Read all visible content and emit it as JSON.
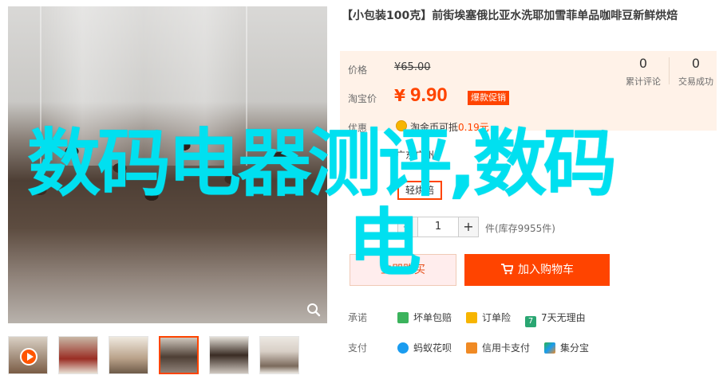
{
  "product": {
    "title": "【小包装100克】前街埃塞俄比亚水洗耶加雪菲单品咖啡豆新鲜烘焙"
  },
  "price": {
    "list_label": "价格",
    "list_price": "¥65.00",
    "promo_label": "淘宝价",
    "currency": "¥",
    "promo_price": "9.90",
    "promo_tag": "爆款促销",
    "reviews_count": "0",
    "reviews_label": "累计评论",
    "trades_count": "0",
    "trades_label": "交易成功",
    "rebate_label": "优惠",
    "rebate_text_prefix": "淘金币可抵",
    "rebate_amount": "0.19元"
  },
  "shipping": {
    "text": "广东广州"
  },
  "option": {
    "label": "轻烘焙"
  },
  "quantity": {
    "minus": "−",
    "value": "1",
    "plus": "+",
    "stock": "件(库存9955件)"
  },
  "actions": {
    "buy_now": "立即购买",
    "add_to_cart": "加入购物车"
  },
  "commitments": {
    "label": "承诺",
    "items": [
      "坏单包赔",
      "订单险",
      "7天无理由"
    ]
  },
  "payment": {
    "label": "支付",
    "items": [
      "蚂蚁花呗",
      "信用卡支付",
      "集分宝"
    ]
  },
  "overlay": {
    "line1": "数码电器测评,数码",
    "line2": "电"
  },
  "colors": {
    "accent": "#ff4400",
    "overlay": "#00e0f0",
    "price_bg": "#fff2e8"
  }
}
